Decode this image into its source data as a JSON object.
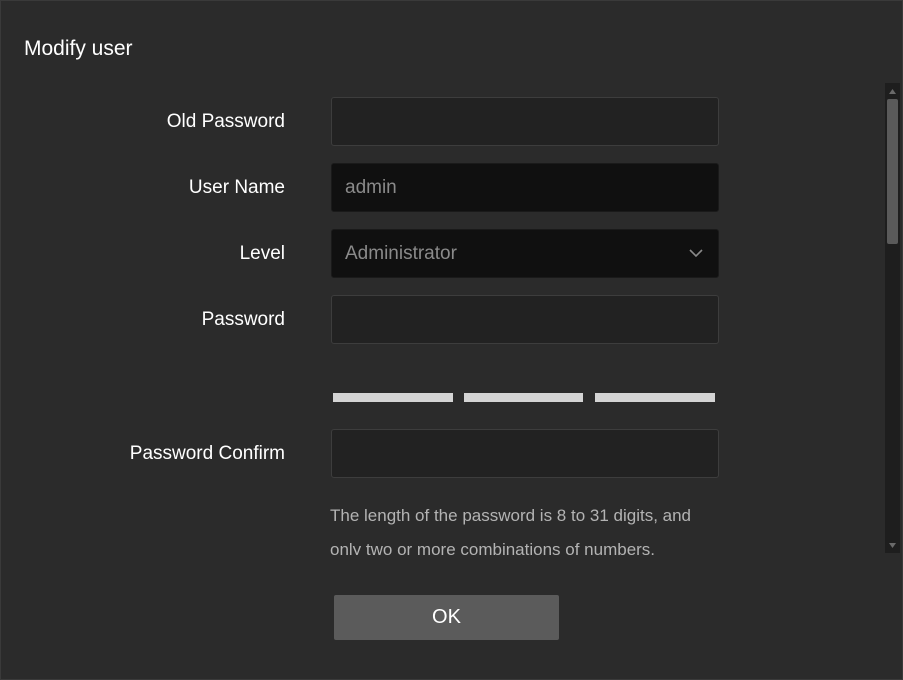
{
  "dialog": {
    "title": "Modify user"
  },
  "form": {
    "old_password": {
      "label": "Old Password",
      "value": ""
    },
    "user_name": {
      "label": "User Name",
      "value": "admin"
    },
    "level": {
      "label": "Level",
      "selected": "Administrator"
    },
    "password": {
      "label": "Password",
      "value": ""
    },
    "password_strength": {
      "segments": 3,
      "filled": 0
    },
    "password_confirm": {
      "label": "Password Confirm",
      "value": ""
    },
    "hint_line1": "The length of the password is 8 to 31 digits, and",
    "hint_line2": "only two or more combinations of numbers,"
  },
  "actions": {
    "ok_label": "OK"
  },
  "icons": {
    "level_dropdown": "chevron-down-icon",
    "scroll_up": "scroll-up-arrow-icon",
    "scroll_down": "scroll-down-arrow-icon"
  },
  "colors": {
    "background": "#2b2b2b",
    "input_bg": "#222222",
    "disabled_bg": "#101010",
    "button_bg": "#5b5b5b",
    "strength_bar": "#d4d4d4"
  }
}
